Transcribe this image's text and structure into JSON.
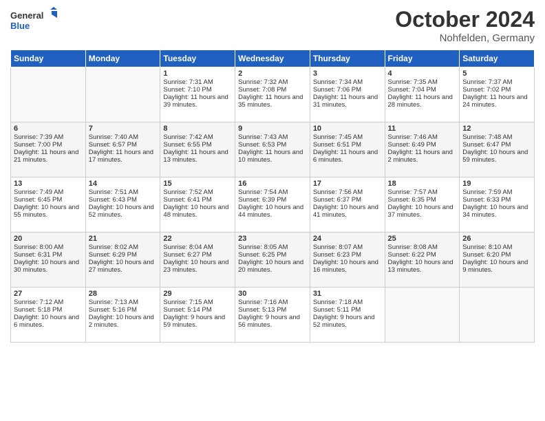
{
  "header": {
    "logo_line1": "General",
    "logo_line2": "Blue",
    "month": "October 2024",
    "location": "Nohfelden, Germany"
  },
  "days_of_week": [
    "Sunday",
    "Monday",
    "Tuesday",
    "Wednesday",
    "Thursday",
    "Friday",
    "Saturday"
  ],
  "weeks": [
    [
      {
        "day": "",
        "content": ""
      },
      {
        "day": "",
        "content": ""
      },
      {
        "day": "1",
        "content": "Sunrise: 7:31 AM\nSunset: 7:10 PM\nDaylight: 11 hours and 39 minutes."
      },
      {
        "day": "2",
        "content": "Sunrise: 7:32 AM\nSunset: 7:08 PM\nDaylight: 11 hours and 35 minutes."
      },
      {
        "day": "3",
        "content": "Sunrise: 7:34 AM\nSunset: 7:06 PM\nDaylight: 11 hours and 31 minutes."
      },
      {
        "day": "4",
        "content": "Sunrise: 7:35 AM\nSunset: 7:04 PM\nDaylight: 11 hours and 28 minutes."
      },
      {
        "day": "5",
        "content": "Sunrise: 7:37 AM\nSunset: 7:02 PM\nDaylight: 11 hours and 24 minutes."
      }
    ],
    [
      {
        "day": "6",
        "content": "Sunrise: 7:39 AM\nSunset: 7:00 PM\nDaylight: 11 hours and 21 minutes."
      },
      {
        "day": "7",
        "content": "Sunrise: 7:40 AM\nSunset: 6:57 PM\nDaylight: 11 hours and 17 minutes."
      },
      {
        "day": "8",
        "content": "Sunrise: 7:42 AM\nSunset: 6:55 PM\nDaylight: 11 hours and 13 minutes."
      },
      {
        "day": "9",
        "content": "Sunrise: 7:43 AM\nSunset: 6:53 PM\nDaylight: 11 hours and 10 minutes."
      },
      {
        "day": "10",
        "content": "Sunrise: 7:45 AM\nSunset: 6:51 PM\nDaylight: 11 hours and 6 minutes."
      },
      {
        "day": "11",
        "content": "Sunrise: 7:46 AM\nSunset: 6:49 PM\nDaylight: 11 hours and 2 minutes."
      },
      {
        "day": "12",
        "content": "Sunrise: 7:48 AM\nSunset: 6:47 PM\nDaylight: 10 hours and 59 minutes."
      }
    ],
    [
      {
        "day": "13",
        "content": "Sunrise: 7:49 AM\nSunset: 6:45 PM\nDaylight: 10 hours and 55 minutes."
      },
      {
        "day": "14",
        "content": "Sunrise: 7:51 AM\nSunset: 6:43 PM\nDaylight: 10 hours and 52 minutes."
      },
      {
        "day": "15",
        "content": "Sunrise: 7:52 AM\nSunset: 6:41 PM\nDaylight: 10 hours and 48 minutes."
      },
      {
        "day": "16",
        "content": "Sunrise: 7:54 AM\nSunset: 6:39 PM\nDaylight: 10 hours and 44 minutes."
      },
      {
        "day": "17",
        "content": "Sunrise: 7:56 AM\nSunset: 6:37 PM\nDaylight: 10 hours and 41 minutes."
      },
      {
        "day": "18",
        "content": "Sunrise: 7:57 AM\nSunset: 6:35 PM\nDaylight: 10 hours and 37 minutes."
      },
      {
        "day": "19",
        "content": "Sunrise: 7:59 AM\nSunset: 6:33 PM\nDaylight: 10 hours and 34 minutes."
      }
    ],
    [
      {
        "day": "20",
        "content": "Sunrise: 8:00 AM\nSunset: 6:31 PM\nDaylight: 10 hours and 30 minutes."
      },
      {
        "day": "21",
        "content": "Sunrise: 8:02 AM\nSunset: 6:29 PM\nDaylight: 10 hours and 27 minutes."
      },
      {
        "day": "22",
        "content": "Sunrise: 8:04 AM\nSunset: 6:27 PM\nDaylight: 10 hours and 23 minutes."
      },
      {
        "day": "23",
        "content": "Sunrise: 8:05 AM\nSunset: 6:25 PM\nDaylight: 10 hours and 20 minutes."
      },
      {
        "day": "24",
        "content": "Sunrise: 8:07 AM\nSunset: 6:23 PM\nDaylight: 10 hours and 16 minutes."
      },
      {
        "day": "25",
        "content": "Sunrise: 8:08 AM\nSunset: 6:22 PM\nDaylight: 10 hours and 13 minutes."
      },
      {
        "day": "26",
        "content": "Sunrise: 8:10 AM\nSunset: 6:20 PM\nDaylight: 10 hours and 9 minutes."
      }
    ],
    [
      {
        "day": "27",
        "content": "Sunrise: 7:12 AM\nSunset: 5:18 PM\nDaylight: 10 hours and 6 minutes."
      },
      {
        "day": "28",
        "content": "Sunrise: 7:13 AM\nSunset: 5:16 PM\nDaylight: 10 hours and 2 minutes."
      },
      {
        "day": "29",
        "content": "Sunrise: 7:15 AM\nSunset: 5:14 PM\nDaylight: 9 hours and 59 minutes."
      },
      {
        "day": "30",
        "content": "Sunrise: 7:16 AM\nSunset: 5:13 PM\nDaylight: 9 hours and 56 minutes."
      },
      {
        "day": "31",
        "content": "Sunrise: 7:18 AM\nSunset: 5:11 PM\nDaylight: 9 hours and 52 minutes."
      },
      {
        "day": "",
        "content": ""
      },
      {
        "day": "",
        "content": ""
      }
    ]
  ]
}
